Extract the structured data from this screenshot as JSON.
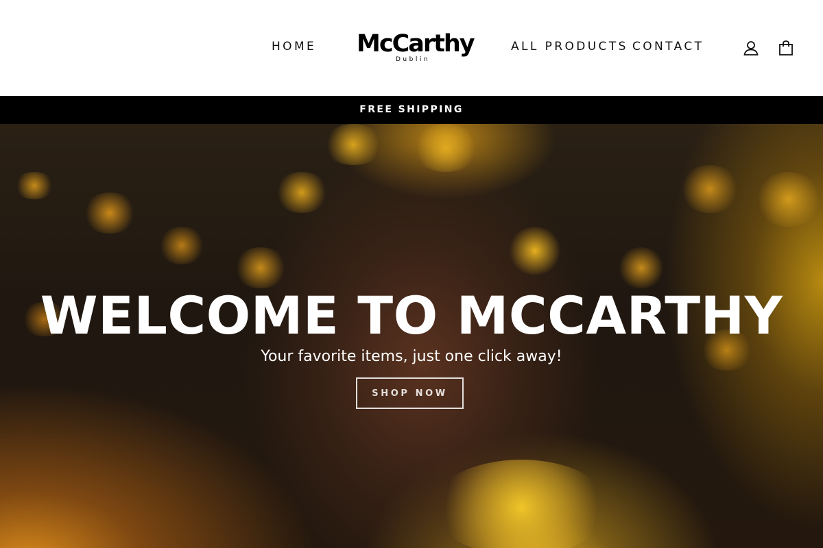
{
  "nav": {
    "home": "HOME",
    "all_products": "ALL PRODUCTS",
    "contact": "CONTACT",
    "account_icon": "user-icon",
    "cart_icon": "shopping-bag-icon"
  },
  "logo": {
    "name": "McCarthy",
    "location": "Dublin"
  },
  "announcement": {
    "text": "FREE SHIPPING"
  },
  "hero": {
    "title": "WELCOME TO MCCARTHY",
    "subtitle": "Your favorite items, just one click away!",
    "button_label": "SHOP NOW"
  },
  "colors": {
    "announcement_bg": "#000000",
    "header_bg": "#ffffff",
    "hero_text": "#ffffff"
  }
}
